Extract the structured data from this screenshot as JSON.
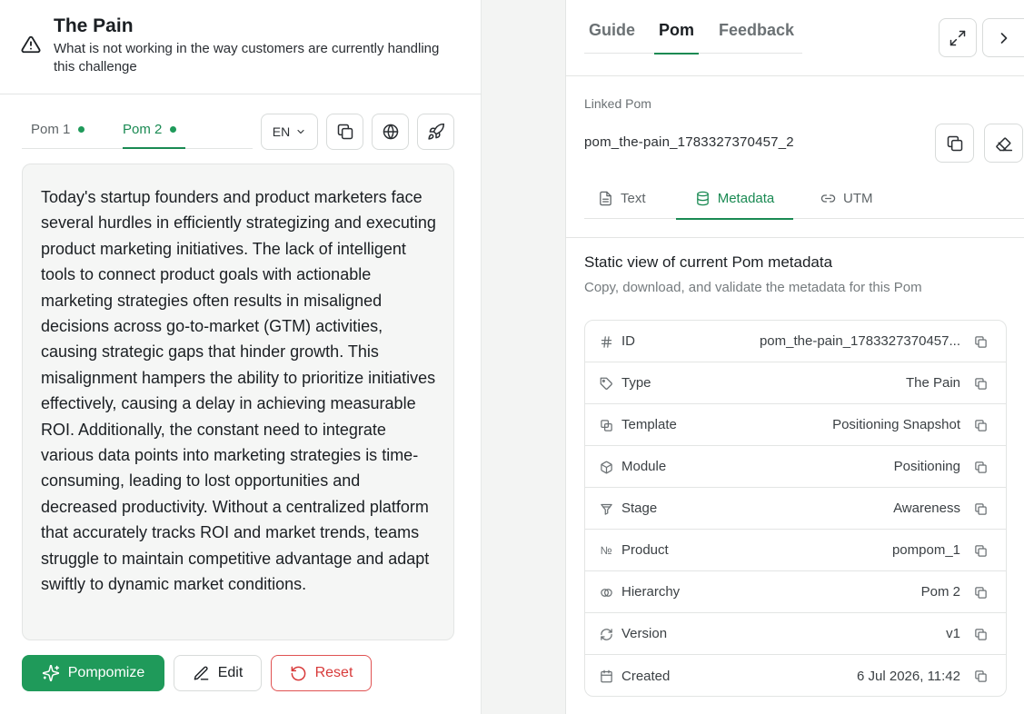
{
  "pain": {
    "title": "The Pain",
    "subtitle": "What is not working in the way customers are currently handling this challenge"
  },
  "pom_tabs": [
    {
      "label": "Pom 1",
      "active": false
    },
    {
      "label": "Pom 2",
      "active": true
    }
  ],
  "toolbar": {
    "language": "EN",
    "icons": [
      "copy-icon",
      "globe-icon",
      "rocket-icon"
    ]
  },
  "pom_text": "Today's startup founders and product marketers face several hurdles in efficiently strategizing and executing product marketing initiatives. The lack of intelligent tools to connect product goals with actionable marketing strategies often results in misaligned decisions across go-to-market (GTM) activities, causing strategic gaps that hinder growth. This misalignment hampers the ability to prioritize initiatives effectively, causing a delay in achieving measurable ROI. Additionally, the constant need to integrate various data points into marketing strategies is time-consuming, leading to lost opportunities and decreased productivity. Without a centralized platform that accurately tracks ROI and market trends, teams struggle to maintain competitive advantage and adapt swiftly to dynamic market conditions.",
  "actions": {
    "pompomize": "Pompomize",
    "edit": "Edit",
    "reset": "Reset"
  },
  "right_tabs": [
    {
      "label": "Guide",
      "active": false
    },
    {
      "label": "Pom",
      "active": true
    },
    {
      "label": "Feedback",
      "active": false
    }
  ],
  "linked": {
    "label": "Linked Pom",
    "value": "pom_the-pain_1783327370457_2"
  },
  "sub_tabs": [
    {
      "label": "Text",
      "icon": "document-icon"
    },
    {
      "label": "Metadata",
      "icon": "database-icon",
      "active": true
    },
    {
      "label": "UTM",
      "icon": "link-icon"
    }
  ],
  "metadata": {
    "title": "Static view of current Pom metadata",
    "description": "Copy, download, and validate the metadata for this Pom",
    "rows": [
      {
        "icon": "hash-icon",
        "label": "ID",
        "value": "pom_the-pain_1783327370457..."
      },
      {
        "icon": "tag-icon",
        "label": "Type",
        "value": "The Pain"
      },
      {
        "icon": "template-icon",
        "label": "Template",
        "value": "Positioning Snapshot"
      },
      {
        "icon": "cube-icon",
        "label": "Module",
        "value": "Positioning"
      },
      {
        "icon": "funnel-icon",
        "label": "Stage",
        "value": "Awareness"
      },
      {
        "icon": "numero-icon",
        "label": "Product",
        "value": "pompom_1"
      },
      {
        "icon": "hierarchy-icon",
        "label": "Hierarchy",
        "value": "Pom 2"
      },
      {
        "icon": "refresh-icon",
        "label": "Version",
        "value": "v1"
      },
      {
        "icon": "calendar-icon",
        "label": "Created",
        "value": "6 Jul 2026, 11:42"
      }
    ]
  },
  "colors": {
    "accent": "#1a8a53",
    "primary_button": "#1f9a5a",
    "danger": "#d83a3a"
  }
}
